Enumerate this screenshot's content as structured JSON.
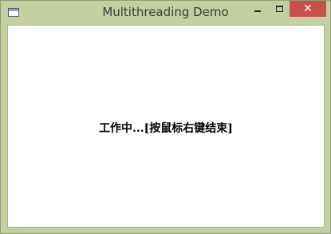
{
  "window": {
    "title": "Multithreading Demo",
    "controls": {
      "minimize_icon": "minimize-icon",
      "maximize_icon": "maximize-icon",
      "close_icon": "close-icon",
      "close_glyph": "✕"
    }
  },
  "content": {
    "status_text": "工作中...[按鼠标右键结束]"
  },
  "colors": {
    "frame": "#c3cfa3",
    "close_button": "#c7504a",
    "client_background": "#ffffff",
    "text": "#000000"
  }
}
